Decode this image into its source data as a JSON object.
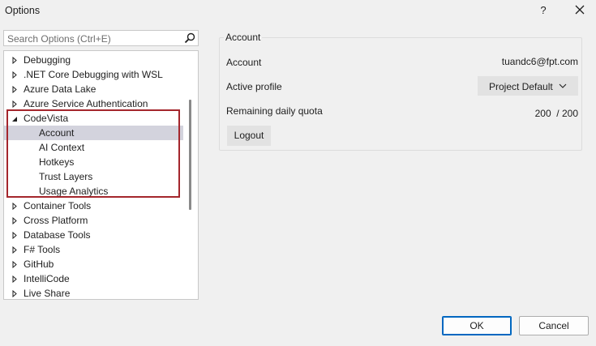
{
  "window": {
    "title": "Options",
    "help_label": "?"
  },
  "search": {
    "placeholder": "Search Options (Ctrl+E)"
  },
  "tree": {
    "items": [
      {
        "label": "Debugging",
        "expanded": false
      },
      {
        "label": ".NET Core Debugging with WSL",
        "expanded": false
      },
      {
        "label": "Azure Data Lake",
        "expanded": false
      },
      {
        "label": "Azure Service Authentication",
        "expanded": false
      },
      {
        "label": "CodeVista",
        "expanded": true
      },
      {
        "label": "Account",
        "child": true,
        "selected": true
      },
      {
        "label": "AI Context",
        "child": true
      },
      {
        "label": "Hotkeys",
        "child": true
      },
      {
        "label": "Trust Layers",
        "child": true
      },
      {
        "label": "Usage Analytics",
        "child": true
      },
      {
        "label": "Container Tools",
        "expanded": false
      },
      {
        "label": "Cross Platform",
        "expanded": false
      },
      {
        "label": "Database Tools",
        "expanded": false
      },
      {
        "label": "F# Tools",
        "expanded": false
      },
      {
        "label": "GitHub",
        "expanded": false
      },
      {
        "label": "IntelliCode",
        "expanded": false
      },
      {
        "label": "Live Share",
        "expanded": false
      }
    ],
    "highlight_color": "#a4262c"
  },
  "account_panel": {
    "group_title": "Account",
    "account_label": "Account",
    "account_value": "tuandc6@fpt.com",
    "profile_label": "Active profile",
    "profile_value": "Project Default",
    "quota_label": "Remaining daily quota",
    "quota_value": "200  / 200",
    "logout_label": "Logout"
  },
  "footer": {
    "ok_label": "OK",
    "cancel_label": "Cancel"
  },
  "colors": {
    "accent": "#0067c0",
    "selected_row": "#d3d3dd"
  }
}
